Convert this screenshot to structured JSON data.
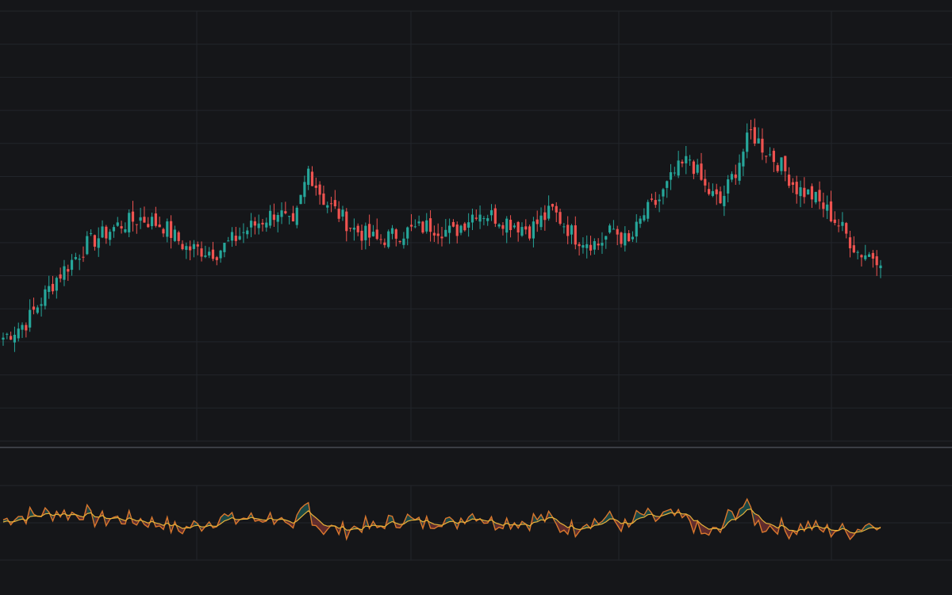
{
  "colors": {
    "background": "#151619",
    "grid": "#22252b",
    "divider": "#3a3d44",
    "up": "#26a69a",
    "down": "#ef5350",
    "osc_fast": "#d9772d",
    "osc_slow": "#e6b23a"
  },
  "chart_data": [
    {
      "type": "candlestick",
      "title": "",
      "xlabel": "",
      "ylabel": "",
      "x_index_range": [
        0,
        230
      ],
      "ylim": [
        0,
        100
      ],
      "grid": true,
      "legend": "none",
      "close_anchors": [
        [
          0,
          18
        ],
        [
          6,
          22
        ],
        [
          14,
          34
        ],
        [
          22,
          43
        ],
        [
          30,
          48
        ],
        [
          36,
          50
        ],
        [
          42,
          48
        ],
        [
          48,
          42
        ],
        [
          56,
          41
        ],
        [
          64,
          47
        ],
        [
          72,
          52
        ],
        [
          76,
          47
        ],
        [
          80,
          63
        ],
        [
          84,
          55
        ],
        [
          92,
          47
        ],
        [
          98,
          44
        ],
        [
          104,
          46
        ],
        [
          112,
          48
        ],
        [
          118,
          46
        ],
        [
          124,
          52
        ],
        [
          130,
          50
        ],
        [
          138,
          47
        ],
        [
          144,
          52
        ],
        [
          150,
          45
        ],
        [
          156,
          43
        ],
        [
          160,
          47
        ],
        [
          164,
          43
        ],
        [
          168,
          51
        ],
        [
          172,
          55
        ],
        [
          176,
          62
        ],
        [
          180,
          66
        ],
        [
          184,
          58
        ],
        [
          188,
          54
        ],
        [
          192,
          63
        ],
        [
          196,
          73
        ],
        [
          200,
          68
        ],
        [
          204,
          64
        ],
        [
          208,
          58
        ],
        [
          212,
          56
        ],
        [
          216,
          52
        ],
        [
          220,
          47
        ],
        [
          224,
          41
        ],
        [
          228,
          40
        ]
      ]
    },
    {
      "type": "line",
      "title": "",
      "ylim": [
        -100,
        100
      ],
      "grid": true,
      "legend": "none",
      "reference_level": 0
    }
  ]
}
